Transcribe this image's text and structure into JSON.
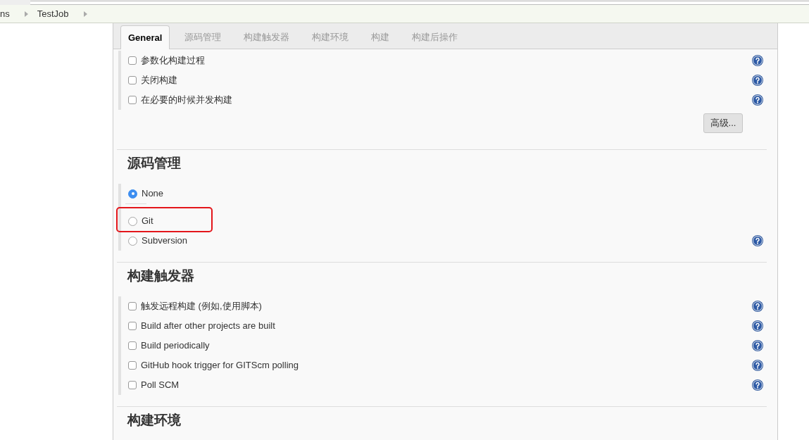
{
  "breadcrumbs": [
    {
      "label": "ns"
    },
    {
      "label": "TestJob"
    }
  ],
  "tabs": [
    {
      "label": "General",
      "selected": true
    },
    {
      "label": "源码管理",
      "selected": false
    },
    {
      "label": "构建触发器",
      "selected": false
    },
    {
      "label": "构建环境",
      "selected": false
    },
    {
      "label": "构建",
      "selected": false
    },
    {
      "label": "构建后操作",
      "selected": false
    }
  ],
  "sections": [
    {
      "items": [
        {
          "kind": "checkbox",
          "label": "参数化构建过程",
          "checked": false,
          "help": true,
          "highlighted": false
        },
        {
          "kind": "checkbox",
          "label": "关闭构建",
          "checked": false,
          "help": true,
          "highlighted": false
        },
        {
          "kind": "checkbox",
          "label": "在必要的时候并发构建",
          "checked": false,
          "help": true,
          "highlighted": false
        }
      ],
      "button": "高级..."
    },
    {
      "title": "源码管理",
      "items": [
        {
          "kind": "radio",
          "label": "None",
          "selected": true,
          "help": false,
          "highlighted": false
        },
        {
          "kind": "radio",
          "label": "Git",
          "selected": false,
          "help": false,
          "highlighted": true
        },
        {
          "kind": "radio",
          "label": "Subversion",
          "selected": false,
          "help": true,
          "highlighted": false
        }
      ]
    },
    {
      "title": "构建触发器",
      "items": [
        {
          "kind": "checkbox",
          "label": "触发远程构建 (例如,使用脚本)",
          "checked": false,
          "help": true,
          "highlighted": false
        },
        {
          "kind": "checkbox",
          "label": "Build after other projects are built",
          "checked": false,
          "help": true,
          "highlighted": false
        },
        {
          "kind": "checkbox",
          "label": "Build periodically",
          "checked": false,
          "help": true,
          "highlighted": false
        },
        {
          "kind": "checkbox",
          "label": "GitHub hook trigger for GITScm polling",
          "checked": false,
          "help": true,
          "highlighted": false
        },
        {
          "kind": "checkbox",
          "label": "Poll SCM",
          "checked": false,
          "help": true,
          "highlighted": false
        }
      ]
    },
    {
      "title": "构建环境"
    }
  ]
}
